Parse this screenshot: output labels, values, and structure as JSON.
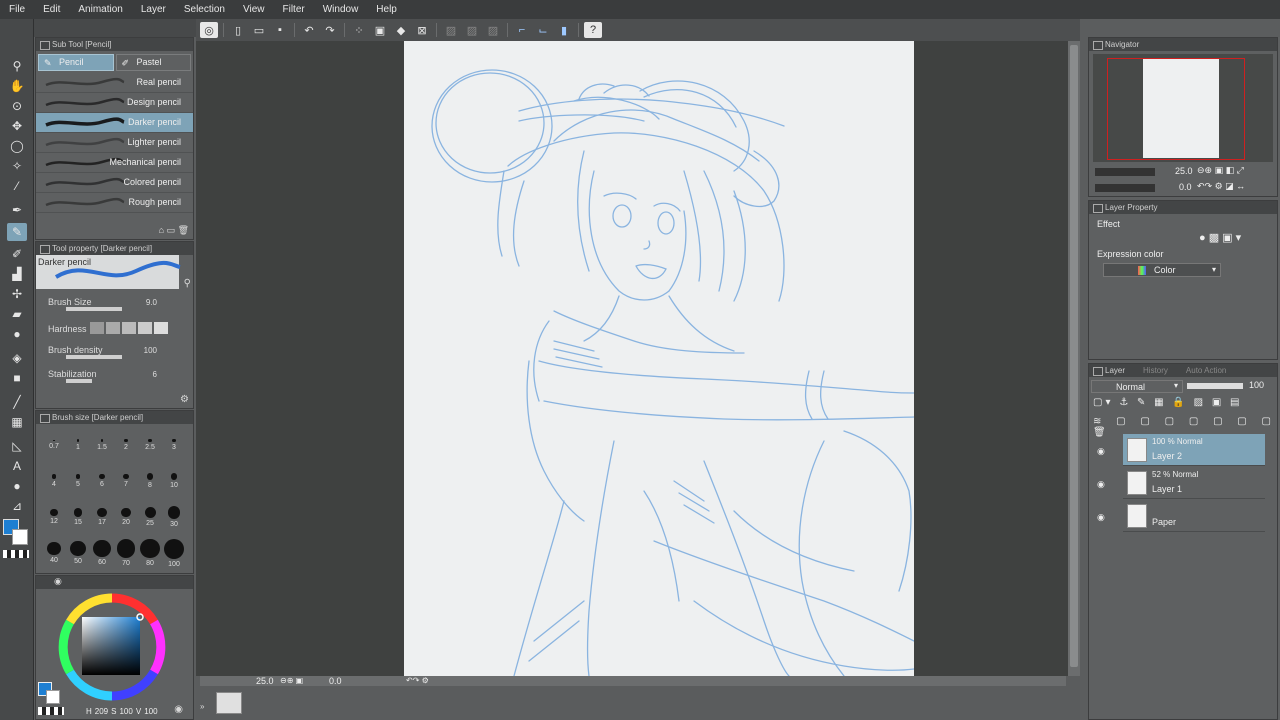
{
  "menu": [
    "File",
    "Edit",
    "Animation",
    "Layer",
    "Selection",
    "View",
    "Filter",
    "Window",
    "Help"
  ],
  "subtool": {
    "header": "Sub Tool [Pencil]",
    "tabs": [
      "Pencil",
      "Pastel"
    ],
    "brushes": [
      "Real pencil",
      "Design pencil",
      "Darker pencil",
      "Lighter pencil",
      "Mechanical pencil",
      "Colored pencil",
      "Rough pencil"
    ],
    "active_index": 2
  },
  "toolprop": {
    "header": "Tool property [Darker pencil]",
    "preview_name": "Darker pencil",
    "brush_size_label": "Brush Size",
    "brush_size_value": "9.0",
    "hardness_label": "Hardness",
    "density_label": "Brush density",
    "density_value": "100",
    "stabilization_label": "Stabilization",
    "stabilization_value": "6"
  },
  "brushsize": {
    "header": "Brush size [Darker pencil]",
    "sizes": [
      "0.7",
      "1",
      "1.5",
      "2",
      "2.5",
      "3",
      "4",
      "5",
      "6",
      "7",
      "8",
      "10",
      "12",
      "15",
      "17",
      "20",
      "25",
      "30",
      "40",
      "50",
      "60",
      "70",
      "80",
      "100"
    ]
  },
  "color": {
    "h_label": "H",
    "h_value": "209",
    "s_label": "S",
    "s_value": "100",
    "v_label": "V",
    "v_value": "100",
    "main_color": "#1e7fd2",
    "stroke_color": "#8ab4e0"
  },
  "bottombar": {
    "zoom": "25.0",
    "angle": "0.0"
  },
  "navigator": {
    "header": "Navigator",
    "zoom": "25.0",
    "angle": "0.0"
  },
  "layerprop": {
    "header": "Layer Property",
    "effect_label": "Effect",
    "expression_label": "Expression color",
    "expression_value": "Color"
  },
  "layers": {
    "tabs": [
      "Layer",
      "History",
      "Auto Action"
    ],
    "blend_mode": "Normal",
    "opacity": "100",
    "items": [
      {
        "info": "100 % Normal",
        "name": "Layer 2"
      },
      {
        "info": "52 % Normal",
        "name": "Layer 1"
      },
      {
        "info": "",
        "name": "Paper"
      }
    ]
  }
}
